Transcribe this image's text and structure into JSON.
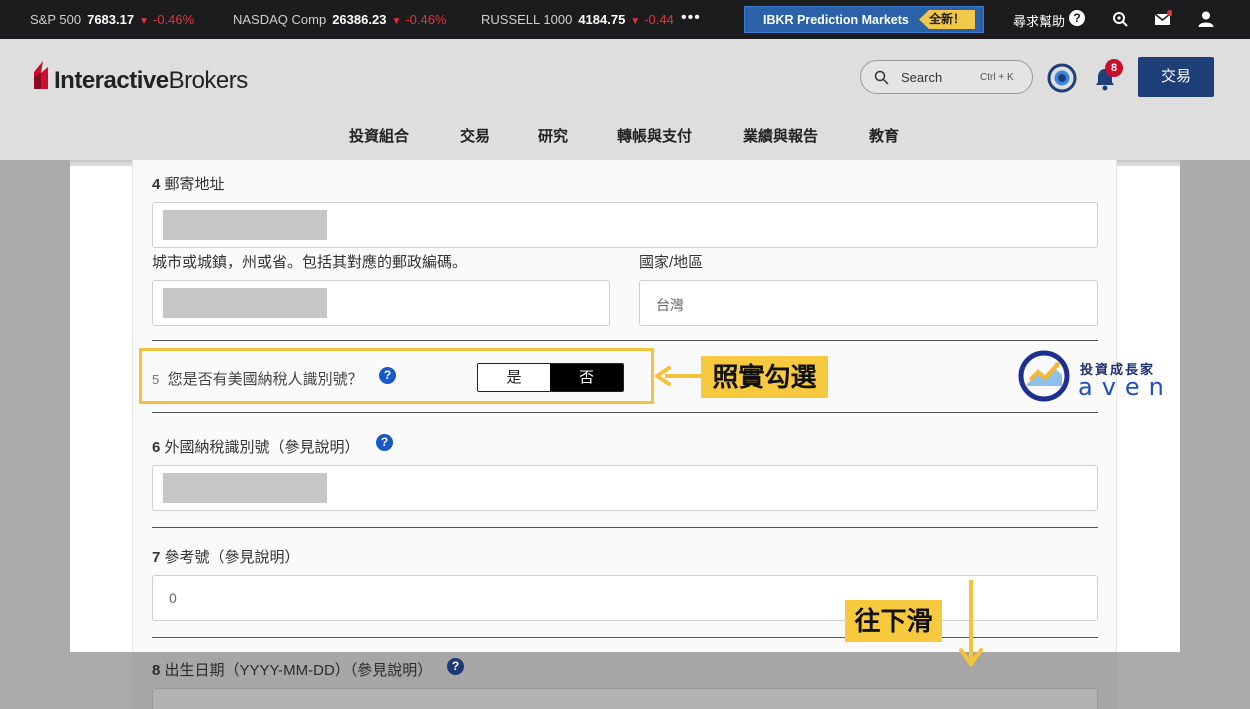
{
  "ticker": {
    "items": [
      {
        "name": "S&P 500",
        "value": "7683.17",
        "change": "-0.46%"
      },
      {
        "name": "NASDAQ Comp",
        "value": "26386.23",
        "change": "-0.46%"
      },
      {
        "name": "RUSSELL 1000",
        "value": "4184.75",
        "change": "-0.44"
      }
    ],
    "more": "•••",
    "prediction_label": "IBKR Prediction Markets",
    "prediction_badge": "全新！",
    "help_label": "尋求幫助"
  },
  "header": {
    "logo_bold": "Interactive",
    "logo_rest": "Brokers",
    "search_label": "Search",
    "search_shortcut": "Ctrl + K",
    "notification_count": "8",
    "trade_button": "交易",
    "nav": [
      "投資組合",
      "交易",
      "研究",
      "轉帳與支付",
      "業績與報告",
      "教育"
    ]
  },
  "form": {
    "q4_num": "4",
    "q4_label": "郵寄地址",
    "city_label": "城市或城鎮，州或省。包括其對應的郵政編碼。",
    "country_label": "國家/地區",
    "country_value": "台灣",
    "q5_num": "5",
    "q5_label": "您是否有美國納稅人識別號？",
    "toggle_yes": "是",
    "toggle_no": "否",
    "q6_num": "6",
    "q6_label": "外國納稅識別號（參見說明）",
    "q7_num": "7",
    "q7_label": "參考號（參見說明）",
    "q7_value": "0",
    "q8_num": "8",
    "q8_label": "出生日期（YYYY-MM-DD）（參見說明）"
  },
  "annotations": {
    "check_note": "照實勾選",
    "scroll_note": "往下滑",
    "brand_cn": "投資成長家",
    "brand_en": "aven",
    "highlight_color": "#f5c33b"
  }
}
